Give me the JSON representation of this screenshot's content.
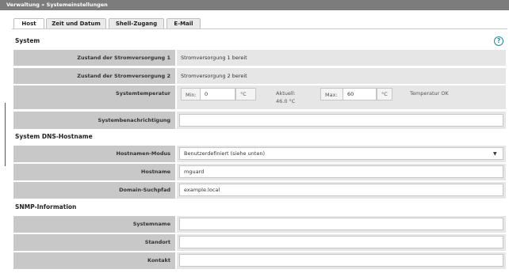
{
  "breadcrumb": "Verwaltung » Systemeinstellungen",
  "tabs": [
    {
      "label": "Host"
    },
    {
      "label": "Zeit und Datum"
    },
    {
      "label": "Shell-Zugang"
    },
    {
      "label": "E-Mail"
    }
  ],
  "help_glyph": "?",
  "sections": {
    "system": {
      "title": "System",
      "power1_label": "Zustand der Stromversorgung 1",
      "power1_value": "Stromversorgung 1 bereit",
      "power2_label": "Zustand der Stromversorgung 2",
      "power2_value": "Stromversorgung 2 bereit",
      "temp_label": "Systemtemperatur",
      "temp_min_label": "Min:",
      "temp_min_value": "0",
      "temp_unit": "°C",
      "temp_current_label": "Aktuell:",
      "temp_current_value": "46.0 °C",
      "temp_max_label": "Max:",
      "temp_max_value": "60",
      "temp_status": "Temperatur OK",
      "notification_label": "Systembenachrichtigung",
      "notification_value": ""
    },
    "dns": {
      "title": "System DNS-Hostname",
      "mode_label": "Hostnamen-Modus",
      "mode_value": "Benutzerdefiniert (siehe unten)",
      "hostname_label": "Hostname",
      "hostname_value": "mguard",
      "domain_label": "Domain-Suchpfad",
      "domain_value": "example.local"
    },
    "snmp": {
      "title": "SNMP-Information",
      "sysname_label": "Systemname",
      "sysname_value": "",
      "location_label": "Standort",
      "location_value": "",
      "contact_label": "Kontakt",
      "contact_value": ""
    }
  },
  "icons": {
    "help": "help-circle-icon",
    "dropdown": "caret-down-icon"
  },
  "colors": {
    "titlebar": "#7c7c7c",
    "label_bg": "#c8c8c8",
    "value_bg": "#e6e6e6",
    "help": "#1a8f9e"
  }
}
